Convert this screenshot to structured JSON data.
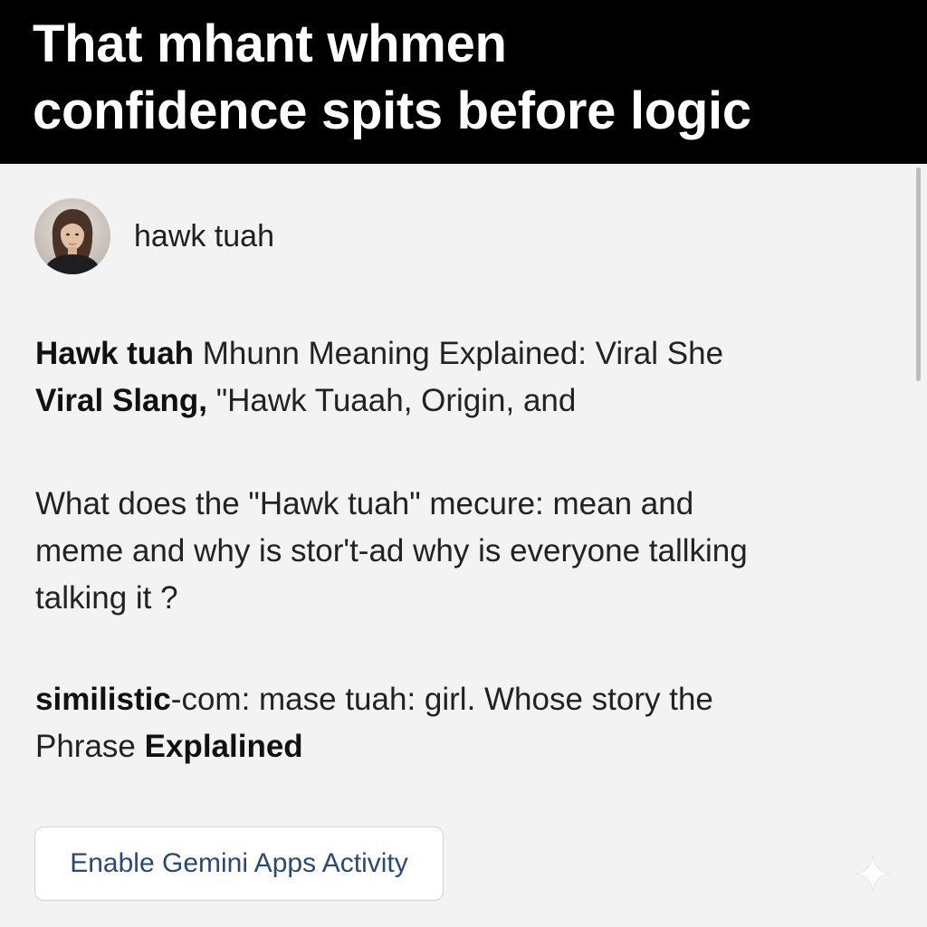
{
  "caption": {
    "line1": "That mhant whmen",
    "line2": "confidence spits before logic"
  },
  "user": {
    "name": "hawk tuah",
    "avatar_icon": "person-avatar"
  },
  "headline": {
    "p1": "Hawk tuah",
    "p2": " Mhunn Meaning Explained: Viral She",
    "p3": "Viral Slang,",
    "p4": "  \"Hawk Tuaah, Origin, and"
  },
  "question": {
    "line1": "What does the \"Hawk tuah\" mecure: mean  and",
    "line2": "meme and why is stor't-ad why is everyone tallking",
    "line3": "talking it  ?"
  },
  "source": {
    "p1": "similistic",
    "p2": "-com: mase tuah:  girl.  Whose story the",
    "p3": "Phrase ",
    "p4": "Explalined"
  },
  "actions": {
    "enable_activity_label": "Enable Gemini Apps Activity"
  },
  "colors": {
    "caption_background": "#000000",
    "caption_text": "#ffffff",
    "page_background": "#f3f3f3",
    "button_text": "#2b4a73"
  },
  "icons": {
    "watermark": "sparkle-icon"
  }
}
